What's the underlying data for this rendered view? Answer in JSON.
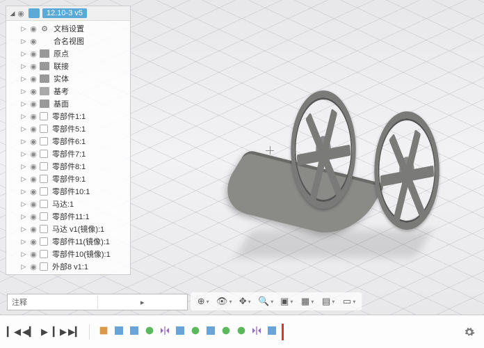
{
  "browser": {
    "doc_name": "12.10-3 v5",
    "items": [
      {
        "label": "文档设置",
        "icon": "gear",
        "indent": 1
      },
      {
        "label": "合名视图",
        "icon": "none",
        "indent": 1
      },
      {
        "label": "原点",
        "icon": "folder",
        "indent": 1
      },
      {
        "label": "联接",
        "icon": "folder",
        "indent": 1
      },
      {
        "label": "实体",
        "icon": "folder",
        "indent": 1
      },
      {
        "label": "基考",
        "icon": "folder-strip",
        "indent": 1
      },
      {
        "label": "基面",
        "icon": "folder",
        "indent": 1
      },
      {
        "label": "零部件1:1",
        "icon": "comp",
        "indent": 1
      },
      {
        "label": "零部件5:1",
        "icon": "comp",
        "indent": 1
      },
      {
        "label": "零部件6:1",
        "icon": "comp",
        "indent": 1
      },
      {
        "label": "零部件7:1",
        "icon": "comp",
        "indent": 1
      },
      {
        "label": "零部件8:1",
        "icon": "comp",
        "indent": 1
      },
      {
        "label": "零部件9:1",
        "icon": "comp",
        "indent": 1
      },
      {
        "label": "零部件10:1",
        "icon": "comp",
        "indent": 1
      },
      {
        "label": "马达:1",
        "icon": "comp",
        "indent": 1
      },
      {
        "label": "零部件11:1",
        "icon": "comp",
        "indent": 1
      },
      {
        "label": "马达 v1(镜像):1",
        "icon": "comp",
        "indent": 1
      },
      {
        "label": "零部件11(镜像):1",
        "icon": "comp",
        "indent": 1
      },
      {
        "label": "零部件10(镜像):1",
        "icon": "comp",
        "indent": 1
      },
      {
        "label": "外部8 v1:1",
        "icon": "comp",
        "indent": 1
      }
    ]
  },
  "comments": {
    "label": "注释"
  },
  "view_tools": [
    {
      "name": "orbit",
      "glyph": "⊕"
    },
    {
      "name": "look-at",
      "glyph": "👁"
    },
    {
      "name": "pan",
      "glyph": "✥"
    },
    {
      "name": "zoom",
      "glyph": "🔍"
    },
    {
      "name": "fit",
      "glyph": "▣"
    },
    {
      "name": "display",
      "glyph": "▦"
    },
    {
      "name": "grid",
      "glyph": "▤"
    },
    {
      "name": "viewports",
      "glyph": "▭"
    }
  ],
  "playback": [
    {
      "name": "rewind",
      "glyph": "▎◀"
    },
    {
      "name": "step-back",
      "glyph": "◀▎"
    },
    {
      "name": "play",
      "glyph": "▶"
    },
    {
      "name": "step-fwd",
      "glyph": "▎▶"
    },
    {
      "name": "fast-fwd",
      "glyph": "▶▎"
    }
  ],
  "timeline_features": [
    {
      "type": "sketch"
    },
    {
      "type": "body"
    },
    {
      "type": "body"
    },
    {
      "type": "joint"
    },
    {
      "type": "mirror"
    },
    {
      "type": "body"
    },
    {
      "type": "joint"
    },
    {
      "type": "body"
    },
    {
      "type": "joint"
    },
    {
      "type": "joint"
    },
    {
      "type": "mirror"
    },
    {
      "type": "body"
    }
  ]
}
